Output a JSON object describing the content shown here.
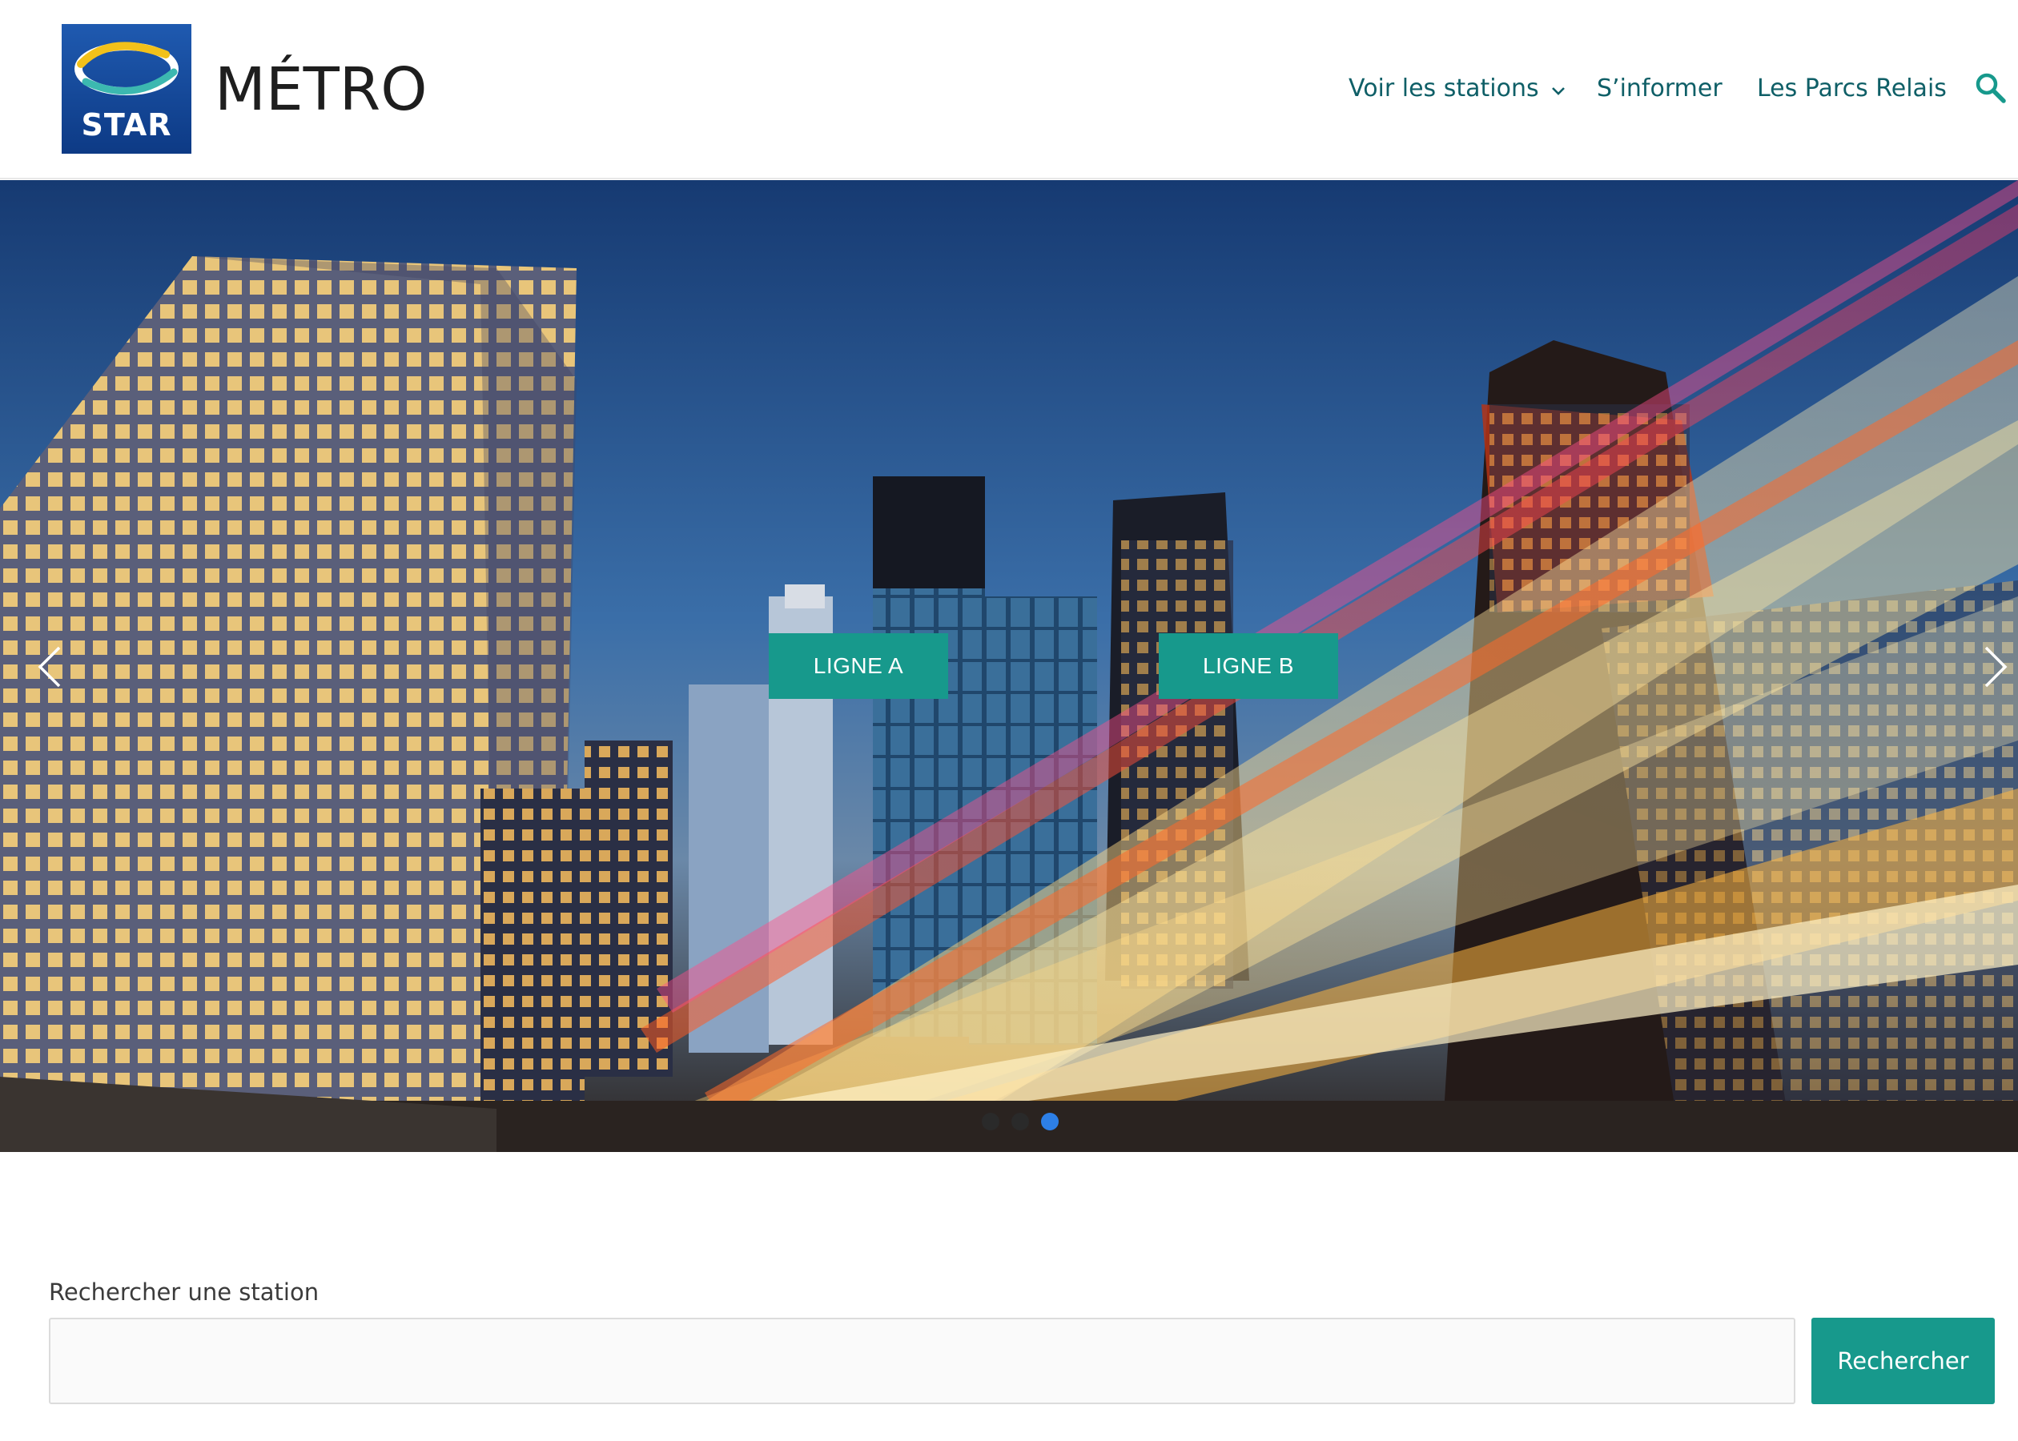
{
  "header": {
    "logo_text": "STAR",
    "site_title": "MÉTRO",
    "nav": [
      {
        "label": "Voir les stations",
        "has_dropdown": true,
        "icon": "chevron-down-icon"
      },
      {
        "label": "S’informer",
        "has_dropdown": false
      },
      {
        "label": "Les Parcs Relais",
        "has_dropdown": false
      }
    ],
    "search_icon": "search-icon"
  },
  "hero": {
    "buttons": [
      {
        "label": "LIGNE A"
      },
      {
        "label": "LIGNE B"
      }
    ],
    "prev_icon": "chevron-left-icon",
    "next_icon": "chevron-right-icon",
    "slides_total": 3,
    "active_slide": 3
  },
  "search": {
    "label": "Rechercher une station",
    "input_value": "",
    "placeholder": "",
    "submit_label": "Rechercher"
  },
  "colors": {
    "accent": "#17998c",
    "nav_text": "#0f5f67",
    "logo_bg": "#13418c",
    "dot_active": "#2d7fe6",
    "dot_inactive": "#2a2a2a"
  }
}
